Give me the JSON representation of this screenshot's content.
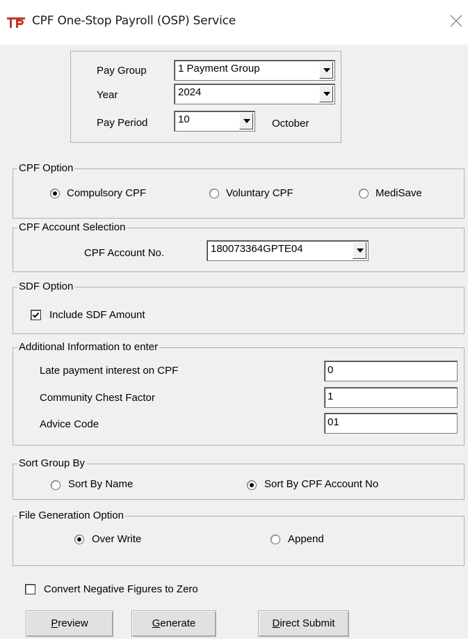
{
  "window": {
    "title": "CPF One-Stop Payroll (OSP) Service",
    "icon": "app-logo-icon",
    "close_icon": "close-icon"
  },
  "period": {
    "pay_group_label": "Pay Group",
    "pay_group_value": "1 Payment Group",
    "year_label": "Year",
    "year_value": "2024",
    "pay_period_label": "Pay Period",
    "pay_period_value": "10",
    "month_name": "October"
  },
  "cpf_option": {
    "title": "CPF Option",
    "options": [
      "Compulsory CPF",
      "Voluntary CPF",
      "MediSave"
    ],
    "selected": "Compulsory CPF"
  },
  "cpf_account": {
    "title": "CPF Account Selection",
    "label": "CPF Account No.",
    "value": "180073364GPTE04"
  },
  "sdf_option": {
    "title": "SDF Option",
    "checkbox_label": "Include SDF Amount",
    "checked": true
  },
  "additional": {
    "title": "Additional Information to enter",
    "fields": [
      {
        "label": "Late payment interest on CPF",
        "value": "0"
      },
      {
        "label": "Community Chest Factor",
        "value": "1"
      },
      {
        "label": "Advice Code",
        "value": "01"
      }
    ]
  },
  "sort_group": {
    "title": "Sort Group By",
    "options": [
      "Sort By Name",
      "Sort By CPF Account No"
    ],
    "selected": "Sort By CPF Account No"
  },
  "file_generation": {
    "title": "File Generation Option",
    "options": [
      "Over Write",
      "Append"
    ],
    "selected": "Over Write"
  },
  "convert_negative": {
    "label": "Convert Negative Figures to Zero",
    "checked": false
  },
  "buttons": {
    "preview": {
      "mnemonic": "P",
      "rest": "review"
    },
    "generate": {
      "mnemonic": "G",
      "rest": "enerate"
    },
    "direct_submit": {
      "mnemonic": "D",
      "rest": "irect Submit"
    }
  }
}
